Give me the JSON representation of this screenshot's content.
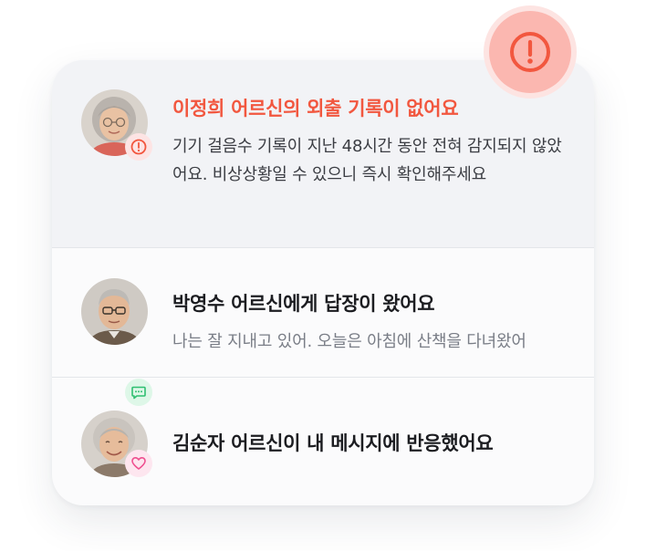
{
  "colors": {
    "alert": "#f2573f",
    "reply_accent": "#2fbf71",
    "reaction_accent": "#ef4f8f",
    "title_text": "#1c1d21",
    "body_text": "#3b3d43",
    "muted_text": "#7a7e87"
  },
  "alert_bubble": {
    "icon": "exclamation-circle-icon"
  },
  "notifications": [
    {
      "type": "alert",
      "title": "이정희 어르신의 외출 기록이 없어요",
      "body": "기기 걸음수 기록이 지난 48시간 동안 전혀 감지되지 않았어요. 비상상황일 수 있으니 즉시 확인해주세요",
      "badge_icon": "alert-icon"
    },
    {
      "type": "reply",
      "title": "박영수 어르신에게 답장이 왔어요",
      "preview": "나는 잘 지내고 있어. 오늘은 아침에 산책을 다녀왔어",
      "badge_icon": "chat-icon"
    },
    {
      "type": "reaction",
      "title": "김순자 어르신이 내 메시지에 반응했어요",
      "badge_icon": "heart-icon"
    }
  ]
}
